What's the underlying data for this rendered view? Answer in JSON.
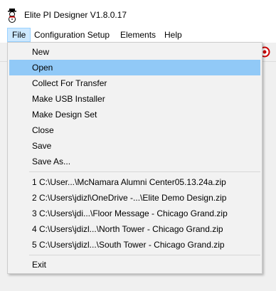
{
  "window": {
    "title": "Elite PI Designer V1.8.0.17",
    "app_icon": "snowman-app-icon"
  },
  "menubar": {
    "items": [
      {
        "label": "File"
      },
      {
        "label": "Configuration Setup"
      },
      {
        "label": "Elements"
      },
      {
        "label": "Help"
      }
    ]
  },
  "toolbar": {
    "icon": "red-circle-icon"
  },
  "file_menu": {
    "items": [
      {
        "label": "New"
      },
      {
        "label": "Open"
      },
      {
        "label": "Collect For Transfer"
      },
      {
        "label": "Make USB Installer"
      },
      {
        "label": "Make Design Set"
      },
      {
        "label": "Close"
      },
      {
        "label": "Save"
      },
      {
        "label": "Save As..."
      }
    ],
    "recent": [
      {
        "label": "1 C:\\User...\\McNamara Alumni Center05.13.24a.zip"
      },
      {
        "label": "2 C:\\Users\\jdizl\\OneDrive -...\\Elite Demo Design.zip"
      },
      {
        "label": "3 C:\\Users\\jdi...\\Floor Message - Chicago Grand.zip"
      },
      {
        "label": "4 C:\\Users\\jdizl...\\North Tower - Chicago Grand.zip"
      },
      {
        "label": "5 C:\\Users\\jdizl...\\South Tower - Chicago Grand.zip"
      }
    ],
    "exit": {
      "label": "Exit"
    }
  },
  "colors": {
    "highlight": "#91c9f7",
    "menu_background": "#f2f2f2",
    "active_menubar": "#cce8ff"
  }
}
